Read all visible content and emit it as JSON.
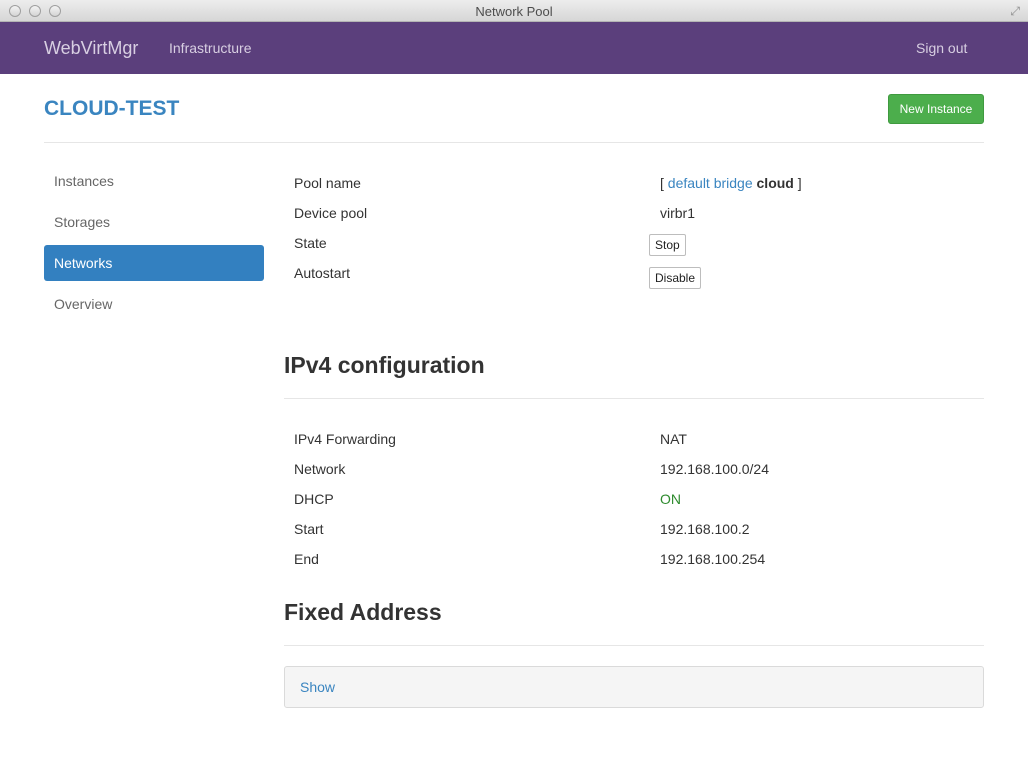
{
  "window": {
    "title": "Network Pool"
  },
  "navbar": {
    "brand": "WebVirtMgr",
    "infrastructure": "Infrastructure",
    "sign_out": "Sign out"
  },
  "page": {
    "title": "CLOUD-TEST",
    "new_instance": "New Instance"
  },
  "sidebar": {
    "items": [
      {
        "label": "Instances",
        "active": false
      },
      {
        "label": "Storages",
        "active": false
      },
      {
        "label": "Networks",
        "active": true
      },
      {
        "label": "Overview",
        "active": false
      }
    ]
  },
  "pool": {
    "pool_name_label": "Pool name",
    "pool_name": {
      "open": "[",
      "link": "default bridge",
      "name": "cloud",
      "close": "]"
    },
    "device_pool_label": "Device pool",
    "device_pool": "virbr1",
    "state_label": "State",
    "state_button": "Stop",
    "autostart_label": "Autostart",
    "autostart_button": "Disable"
  },
  "ipv4": {
    "title": "IPv4 configuration",
    "rows": [
      {
        "label": "IPv4 Forwarding",
        "value": "NAT"
      },
      {
        "label": "Network",
        "value": "192.168.100.0/24"
      },
      {
        "label": "DHCP",
        "value": "ON"
      },
      {
        "label": "Start",
        "value": "192.168.100.2"
      },
      {
        "label": "End",
        "value": "192.168.100.254"
      }
    ]
  },
  "fixed": {
    "title": "Fixed Address",
    "show": "Show"
  },
  "colors": {
    "navbar": "#5b3f7c",
    "accent": "#3a85c0",
    "success": "#4cae4c",
    "on": "#2e8b2e"
  }
}
